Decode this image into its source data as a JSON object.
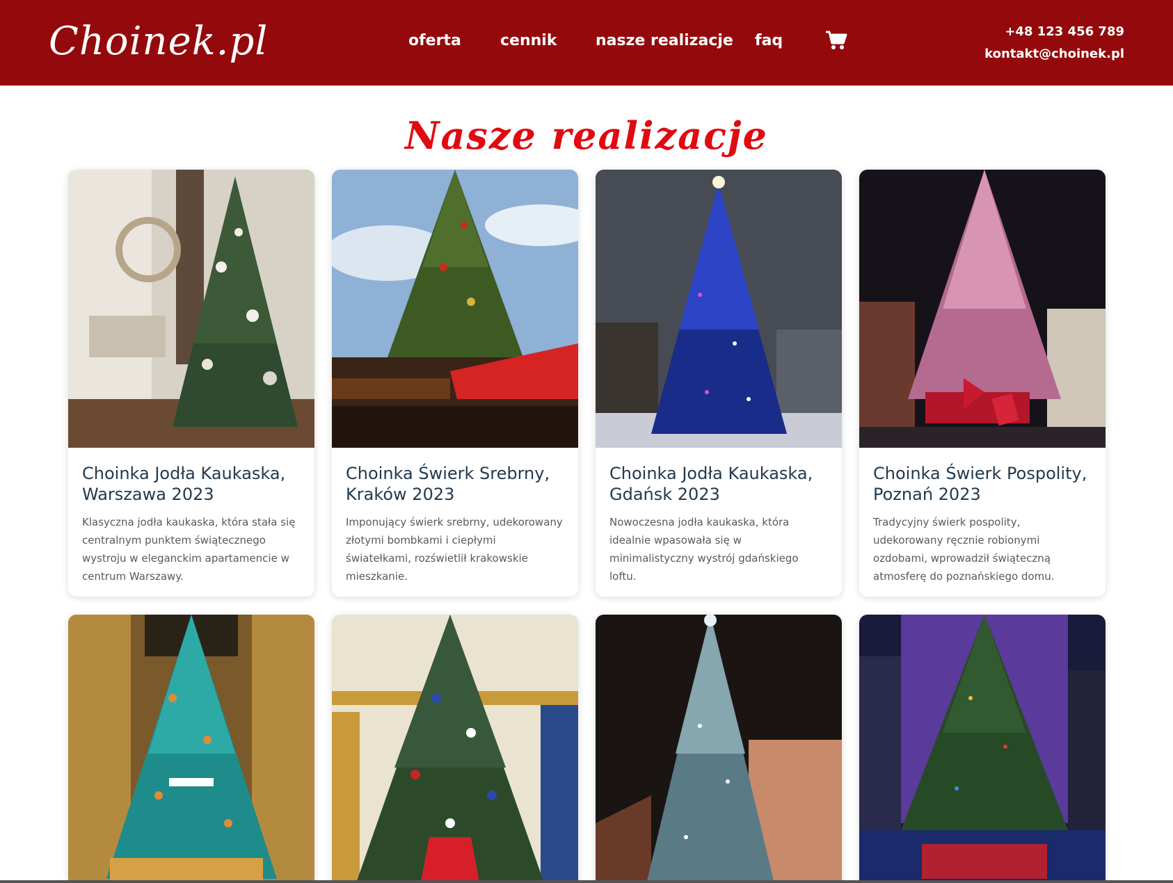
{
  "header": {
    "logo": "Choinek.pl",
    "nav": [
      {
        "label": "oferta"
      },
      {
        "label": "cennik"
      },
      {
        "label": "nasze realizacje"
      },
      {
        "label": "faq"
      }
    ],
    "cart_icon": "shopping-cart-icon",
    "phone": "+48 123 456 789",
    "email": "kontakt@choinek.pl"
  },
  "page": {
    "title": "Nasze realizacje"
  },
  "colors": {
    "header_bg": "#940a0c",
    "title": "#e10a10",
    "card_title": "#233a4e"
  },
  "cards": [
    {
      "title": "Choinka Jodła Kaukaska, Warszawa 2023",
      "description": "Klasyczna jodła kaukaska, która stała się centralnym punktem świątecznego wystroju w eleganckim apartamencie w centrum Warszawy."
    },
    {
      "title": "Choinka Świerk Srebrny, Kraków 2023",
      "description": "Imponujący świerk srebrny, udekorowany złotymi bombkami i ciepłymi światełkami, rozświetlił krakowskie mieszkanie."
    },
    {
      "title": "Choinka Jodła Kaukaska, Gdańsk 2023",
      "description": "Nowoczesna jodła kaukaska, która idealnie wpasowała się w minimalistyczny wystrój gdańskiego loftu."
    },
    {
      "title": "Choinka Świerk Pospolity, Poznań 2023",
      "description": "Tradycyjny świerk pospolity, udekorowany ręcznie robionymi ozdobami, wprowadził świąteczną atmosferę do poznańskiego domu."
    }
  ]
}
